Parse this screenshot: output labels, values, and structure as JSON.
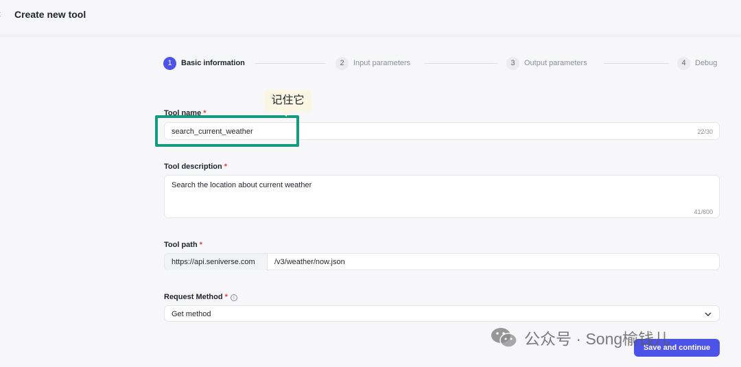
{
  "header": {
    "title": "Create new tool",
    "back_icon": "back-chevron-icon"
  },
  "steps": [
    {
      "num": "1",
      "label": "Basic information",
      "active": true
    },
    {
      "num": "2",
      "label": "Input parameters",
      "active": false
    },
    {
      "num": "3",
      "label": "Output parameters",
      "active": false
    },
    {
      "num": "4",
      "label": "Debug",
      "active": false
    }
  ],
  "form": {
    "tool_name": {
      "label": "Tool name",
      "required": "*",
      "value": "search_current_weather",
      "counter": "22/30"
    },
    "tool_description": {
      "label": "Tool description",
      "required": "*",
      "value": "Search the location about current weather",
      "counter": "41/600"
    },
    "tool_path": {
      "label": "Tool path",
      "required": "*",
      "prefix": "https://api.seniverse.com",
      "value": "/v3/weather/now.json"
    },
    "request_method": {
      "label": "Request Method",
      "required": "*",
      "value": "Get method",
      "info_icon": "info-circle-icon"
    }
  },
  "annotation": {
    "tooltip": "记住它",
    "highlight_color": "#149b7e"
  },
  "actions": {
    "save_label": "Save and continue"
  },
  "watermark": {
    "text": "公众号 · Song榆钱儿"
  },
  "colors": {
    "accent": "#4d53e8",
    "required": "#e03e3e",
    "background": "#f7f7f9"
  }
}
